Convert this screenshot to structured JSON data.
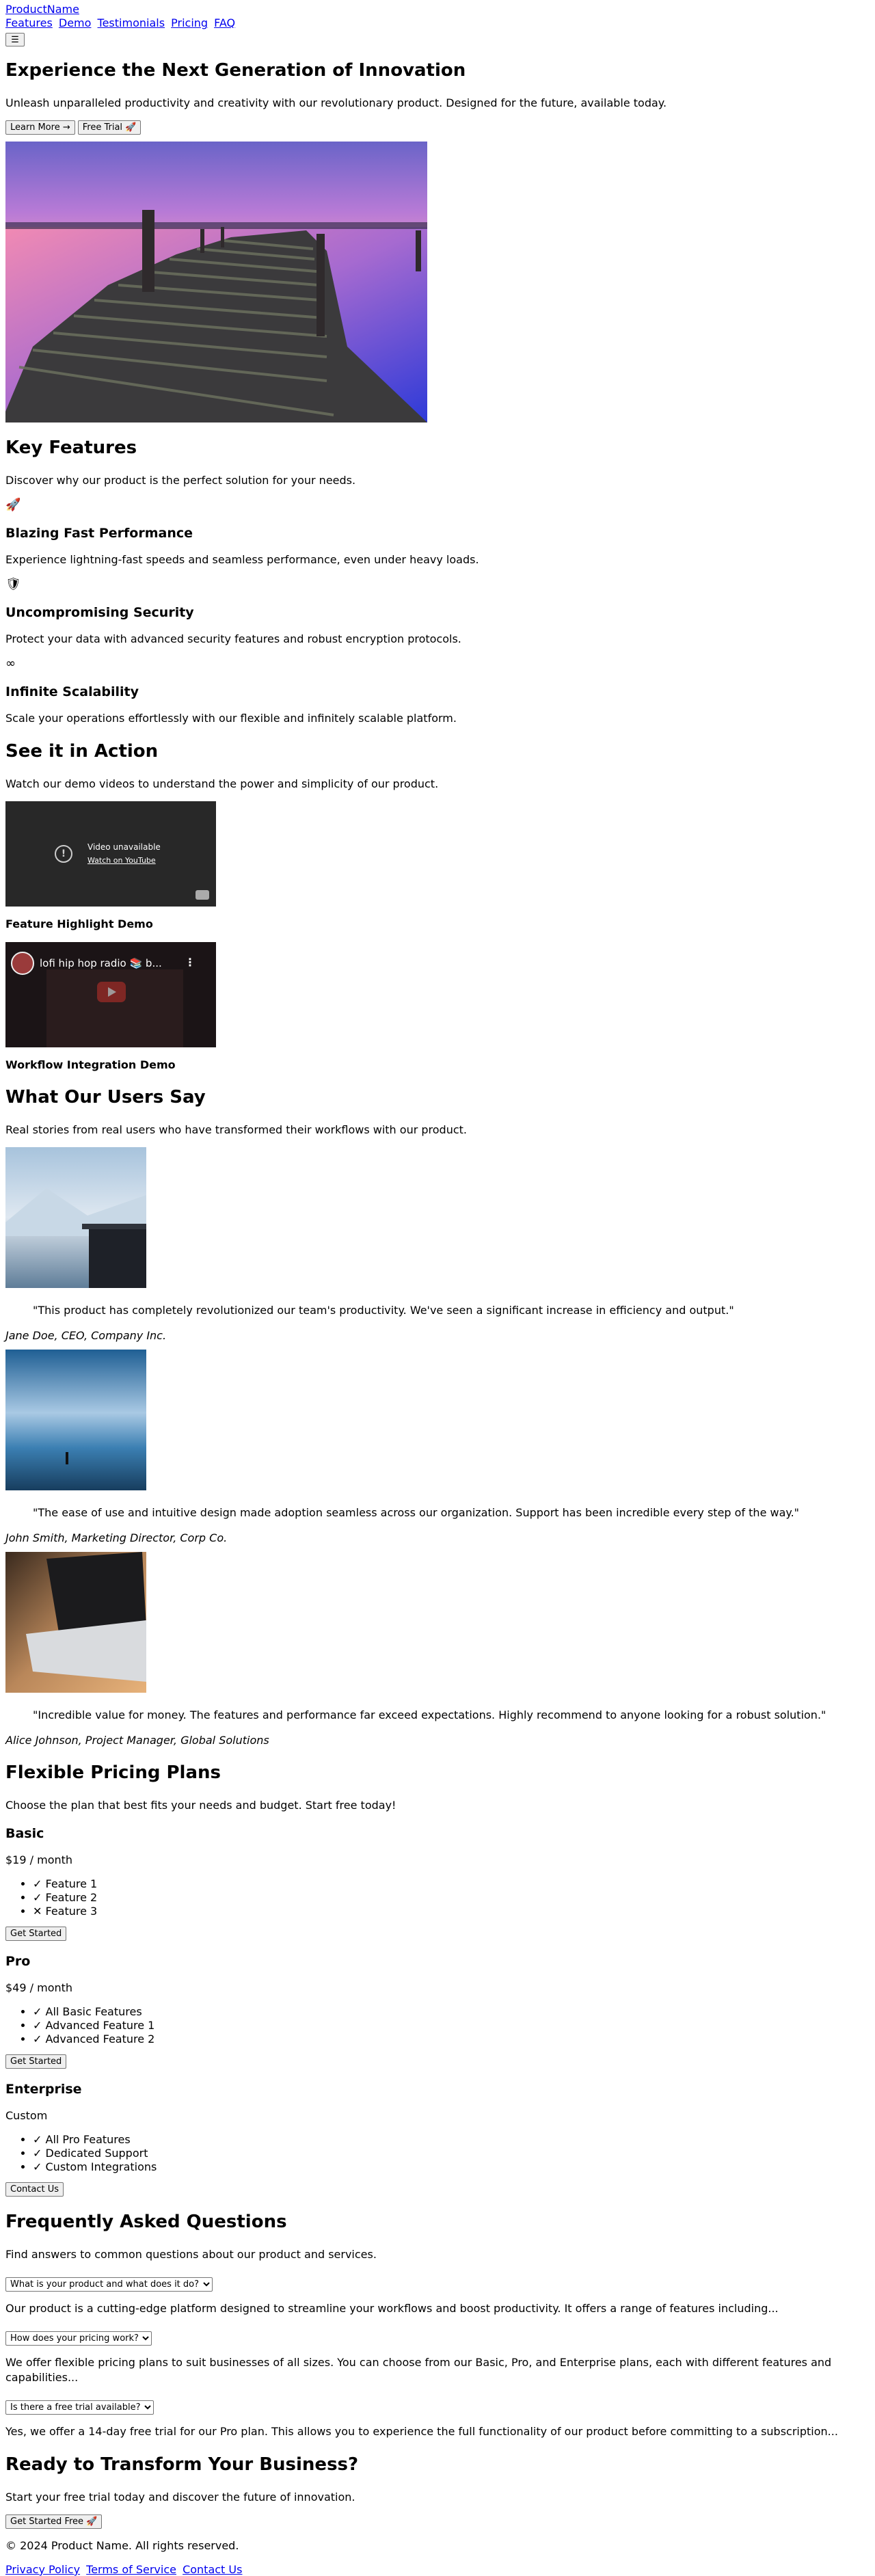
{
  "header": {
    "logo": "ProductName",
    "nav": [
      "Features",
      "Demo",
      "Testimonials",
      "Pricing",
      "FAQ"
    ],
    "menu_icon": "hamburger-icon",
    "menu_glyph": "☰"
  },
  "hero": {
    "title": "Experience the Next Generation of Innovation",
    "subtitle": "Unleash unparalleled productivity and creativity with our revolutionary product. Designed for the future, available today.",
    "learn_more": "Learn More",
    "learn_more_icon": "→",
    "free_trial": "Free Trial",
    "free_trial_icon": "🚀"
  },
  "features": {
    "title": "Key Features",
    "subtitle": "Discover why our product is the perfect solution for your needs.",
    "items": [
      {
        "icon": "rocket-icon",
        "glyph": "🚀",
        "title": "Blazing Fast Performance",
        "text": "Experience lightning-fast speeds and seamless performance, even under heavy loads."
      },
      {
        "icon": "shield-icon",
        "glyph": "🛡",
        "title": "Uncompromising Security",
        "text": "Protect your data with advanced security features and robust encryption protocols."
      },
      {
        "icon": "infinity-icon",
        "glyph": "∞",
        "title": "Infinite Scalability",
        "text": "Scale your operations effortlessly with our flexible and infinitely scalable platform."
      }
    ]
  },
  "demo": {
    "title": "See it in Action",
    "subtitle": "Watch our demo videos to understand the power and simplicity of our product.",
    "video1": {
      "unavailable": "Video unavailable",
      "watch": "Watch on YouTube",
      "caption": "Feature Highlight Demo"
    },
    "video2": {
      "title": "lofi hip hop radio 📚 b...",
      "caption": "Workflow Integration Demo"
    }
  },
  "testimonials": {
    "title": "What Our Users Say",
    "subtitle": "Real stories from real users who have transformed their workflows with our product.",
    "items": [
      {
        "quote": "\"This product has completely revolutionized our team's productivity. We've seen a significant increase in efficiency and output.\"",
        "author": "Jane Doe, CEO, Company Inc."
      },
      {
        "quote": "\"The ease of use and intuitive design made adoption seamless across our organization. Support has been incredible every step of the way.\"",
        "author": "John Smith, Marketing Director, Corp Co."
      },
      {
        "quote": "\"Incredible value for money. The features and performance far exceed expectations. Highly recommend to anyone looking for a robust solution.\"",
        "author": "Alice Johnson, Project Manager, Global Solutions"
      }
    ]
  },
  "pricing": {
    "title": "Flexible Pricing Plans",
    "subtitle": "Choose the plan that best fits your needs and budget. Start free today!",
    "plans": [
      {
        "name": "Basic",
        "price": "$19 / month",
        "features": [
          {
            "mark": "✓",
            "text": "Feature 1"
          },
          {
            "mark": "✓",
            "text": "Feature 2"
          },
          {
            "mark": "✕",
            "text": "Feature 3"
          }
        ],
        "cta": "Get Started"
      },
      {
        "name": "Pro",
        "price": "$49 / month",
        "features": [
          {
            "mark": "✓",
            "text": "All Basic Features"
          },
          {
            "mark": "✓",
            "text": "Advanced Feature 1"
          },
          {
            "mark": "✓",
            "text": "Advanced Feature 2"
          }
        ],
        "cta": "Get Started"
      },
      {
        "name": "Enterprise",
        "price": "Custom",
        "features": [
          {
            "mark": "✓",
            "text": "All Pro Features"
          },
          {
            "mark": "✓",
            "text": "Dedicated Support"
          },
          {
            "mark": "✓",
            "text": "Custom Integrations"
          }
        ],
        "cta": "Contact Us"
      }
    ]
  },
  "faq": {
    "title": "Frequently Asked Questions",
    "subtitle": "Find answers to common questions about our product and services.",
    "items": [
      {
        "q": "What is your product and what does it do?",
        "a": "Our product is a cutting-edge platform designed to streamline your workflows and boost productivity. It offers a range of features including..."
      },
      {
        "q": "How does your pricing work?",
        "a": "We offer flexible pricing plans to suit businesses of all sizes. You can choose from our Basic, Pro, and Enterprise plans, each with different features and capabilities..."
      },
      {
        "q": "Is there a free trial available?",
        "a": "Yes, we offer a 14-day free trial for our Pro plan. This allows you to experience the full functionality of our product before committing to a subscription..."
      }
    ]
  },
  "cta": {
    "title": "Ready to Transform Your Business?",
    "subtitle": "Start your free trial today and discover the future of innovation.",
    "button": "Get Started Free",
    "button_icon": "🚀"
  },
  "footer": {
    "copyright": "© 2024 Product Name. All rights reserved.",
    "links": [
      "Privacy Policy",
      "Terms of Service",
      "Contact Us"
    ]
  }
}
